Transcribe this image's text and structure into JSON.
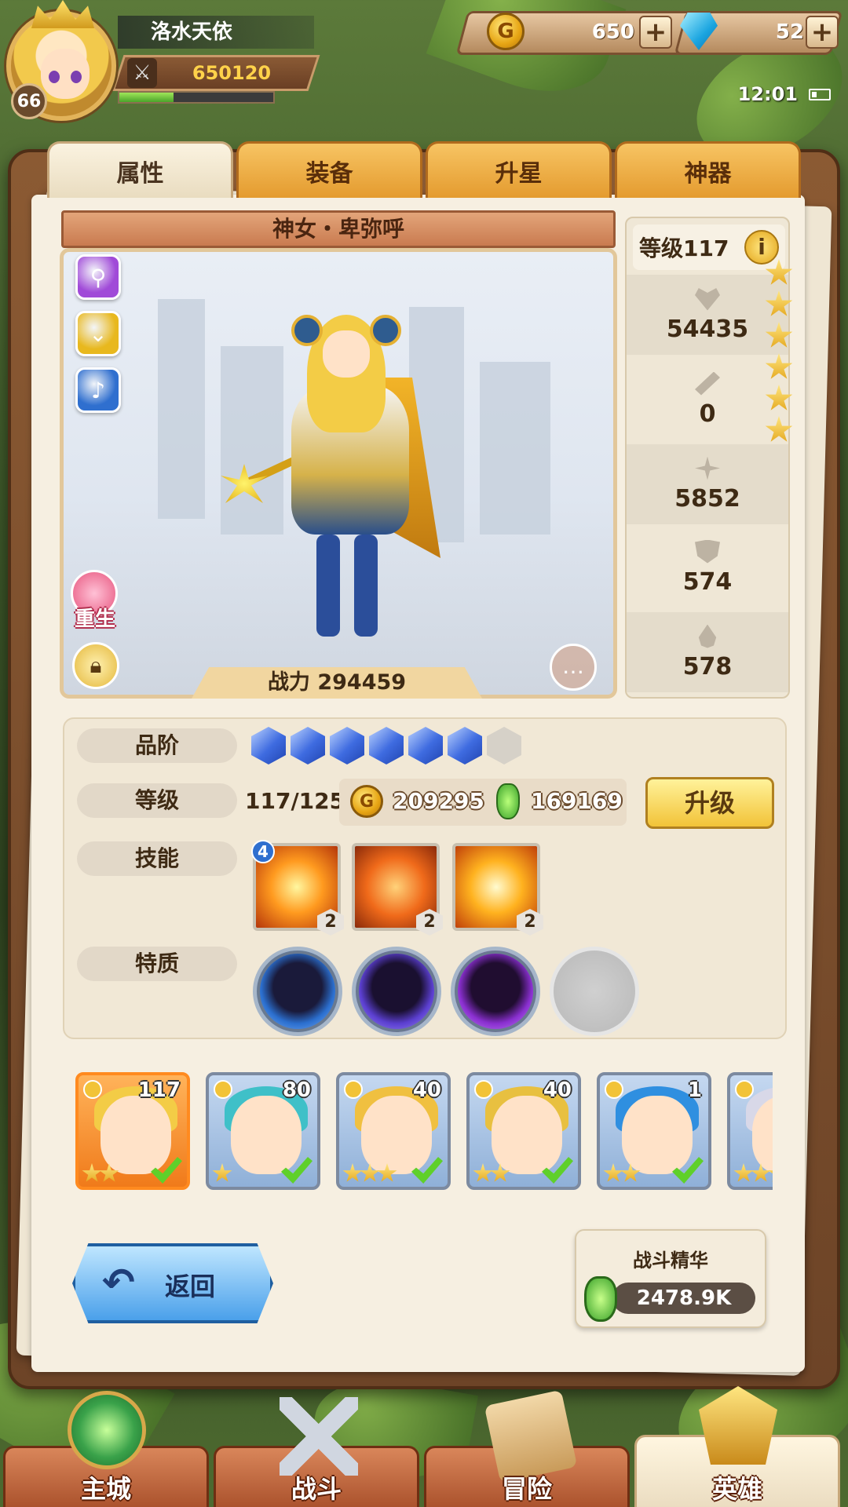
{
  "player": {
    "name": "洛水天依",
    "level": "66",
    "power": "650120",
    "exp_fraction": 0.35
  },
  "resources": {
    "gold": "650",
    "gems": "52"
  },
  "status": {
    "time": "12:01"
  },
  "tabs": [
    {
      "label": "属性",
      "active": true
    },
    {
      "label": "装备",
      "active": false
    },
    {
      "label": "升星",
      "active": false
    },
    {
      "label": "神器",
      "active": false
    }
  ],
  "hero": {
    "name": "神女・卑弥呼",
    "stars": 6,
    "battle_power_label": "战力 294459",
    "rebirth_label": "重生",
    "skill_buttons": [
      "wand-icon",
      "chevron-badge-icon",
      "music-note-icon"
    ],
    "skill_button_colors": [
      "#a04ad8",
      "#e8b81e",
      "#2f6fcf"
    ]
  },
  "stats": {
    "level_label": "等级117",
    "hp": "54435",
    "attack": "0",
    "crit": "5852",
    "defense": "574",
    "resist": "578"
  },
  "detail": {
    "rank_label": "品阶",
    "rank_filled": 6,
    "rank_total": 7,
    "level_label": "等级",
    "level_value": "117/125",
    "gold_cost": "209295",
    "potion_cost": "169169",
    "upgrade_label": "升级",
    "skills_label": "技能",
    "skills": [
      {
        "level_badge": "4",
        "count": "2"
      },
      {
        "level_badge": "",
        "count": "2"
      },
      {
        "level_badge": "",
        "count": "2"
      }
    ],
    "traits_label": "特质",
    "traits": [
      "blue",
      "purple",
      "violet",
      "empty"
    ]
  },
  "roster": [
    {
      "level": "117",
      "hair": "#f3cc46",
      "stars": 2,
      "selected": true,
      "checked": true
    },
    {
      "level": "80",
      "hair": "#3fc0c8",
      "stars": 1,
      "selected": false,
      "checked": true
    },
    {
      "level": "40",
      "hair": "#f0c040",
      "stars": 3,
      "selected": false,
      "checked": true
    },
    {
      "level": "40",
      "hair": "#e8c040",
      "stars": 2,
      "selected": false,
      "checked": true
    },
    {
      "level": "1",
      "hair": "#2f8fe0",
      "stars": 2,
      "selected": false,
      "checked": true
    },
    {
      "level": "",
      "hair": "#d8d8e8",
      "stars": 3,
      "selected": false,
      "checked": false
    }
  ],
  "footer": {
    "back_label": "返回",
    "essence_title": "战斗精华",
    "essence_value": "2478.9K"
  },
  "nav": [
    {
      "label": "主城",
      "active": false
    },
    {
      "label": "战斗",
      "active": false
    },
    {
      "label": "冒险",
      "active": false
    },
    {
      "label": "英雄",
      "active": true
    }
  ]
}
